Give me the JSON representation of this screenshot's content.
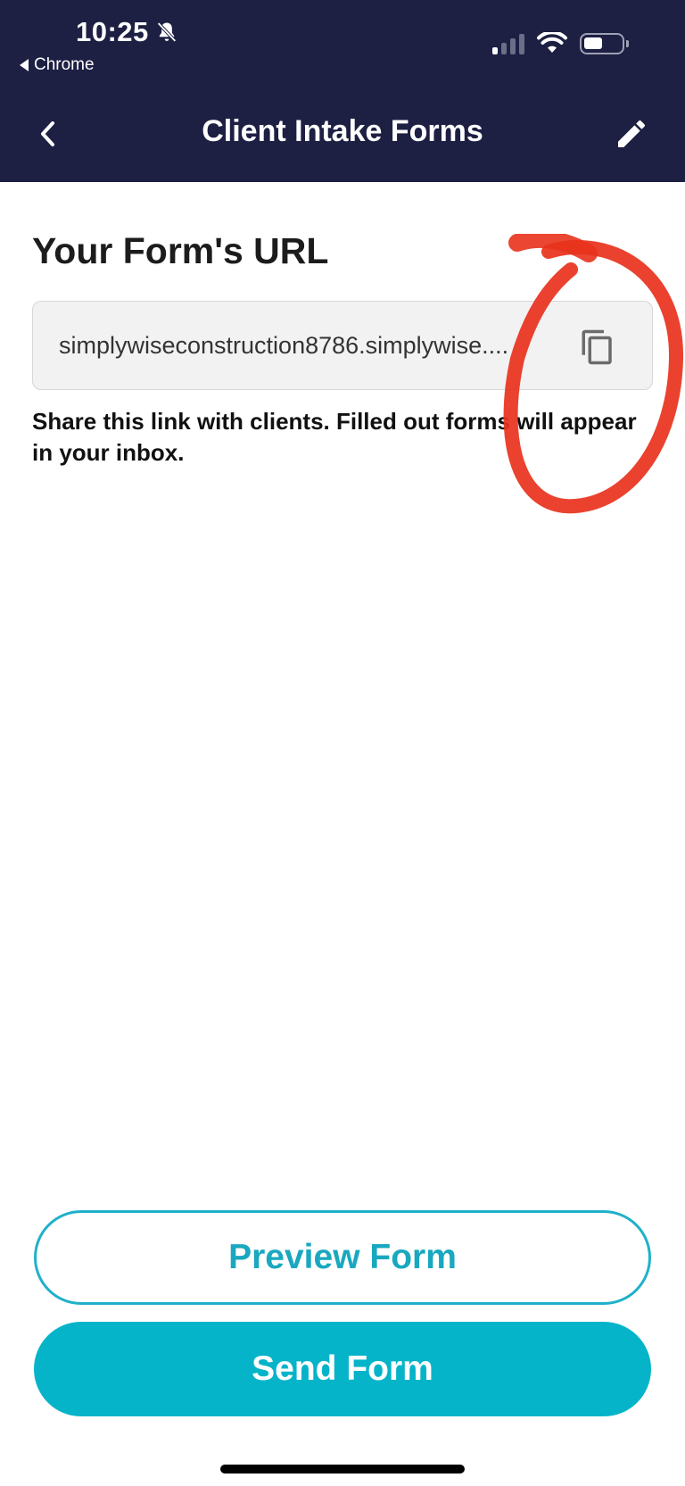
{
  "status_bar": {
    "time": "10:25",
    "back_app_label": "Chrome",
    "icons": [
      "bell-slash-icon",
      "cellular-signal-icon",
      "wifi-icon",
      "battery-icon"
    ]
  },
  "nav": {
    "title": "Client Intake Forms",
    "back_icon": "chevron-left-icon",
    "edit_icon": "pencil-icon"
  },
  "form_url": {
    "heading": "Your Form's URL",
    "url": "simplywiseconstruction8786.simplywise....",
    "copy_icon": "copy-icon",
    "helper_text": "Share this link with clients. Filled out forms will appear in your inbox."
  },
  "actions": {
    "preview_label": "Preview Form",
    "send_label": "Send Form"
  },
  "colors": {
    "header_bg": "#1d2043",
    "accent": "#05b4c9",
    "annotation": "#e8321c"
  }
}
